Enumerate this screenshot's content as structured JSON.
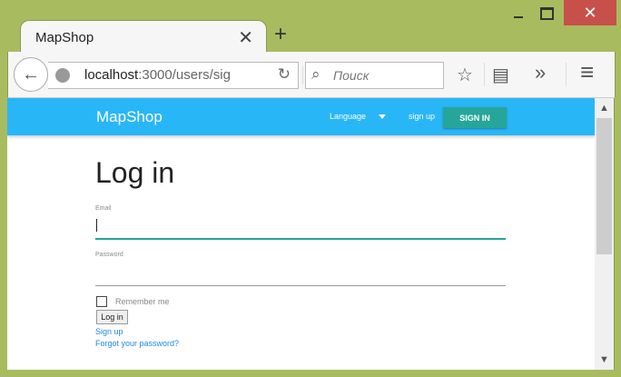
{
  "window": {
    "minimize_icon": "minimize-icon",
    "maximize_icon": "maximize-icon",
    "close_glyph": "✕"
  },
  "tab": {
    "title": "MapShop",
    "close_glyph": "✕",
    "new_tab_glyph": "+"
  },
  "toolbar": {
    "back_glyph": "←",
    "url_host": "localhost",
    "url_path": ":3000/users/sig",
    "reload_glyph": "↻",
    "search_placeholder": "Поиск",
    "search_glyph": "⌕",
    "bookmark_glyph": "☆",
    "reading_list_glyph": "▤",
    "overflow_glyph": "»",
    "menu_glyph": "≡"
  },
  "navbar": {
    "brand": "MapShop",
    "language_label": "Language",
    "signup_label": "sign up",
    "signin_label": "SIGN IN",
    "color": "#29b6f6",
    "accent": "#26a69a"
  },
  "form": {
    "title": "Log in",
    "email_label": "Email",
    "email_value": "",
    "password_label": "Password",
    "password_value": "",
    "remember_label": "Remember me",
    "remember_checked": false,
    "submit_label": "Log in",
    "signup_link": "Sign up",
    "forgot_link": "Forgot your password?"
  },
  "scrollbar": {
    "up_glyph": "▲",
    "down_glyph": "▼"
  }
}
